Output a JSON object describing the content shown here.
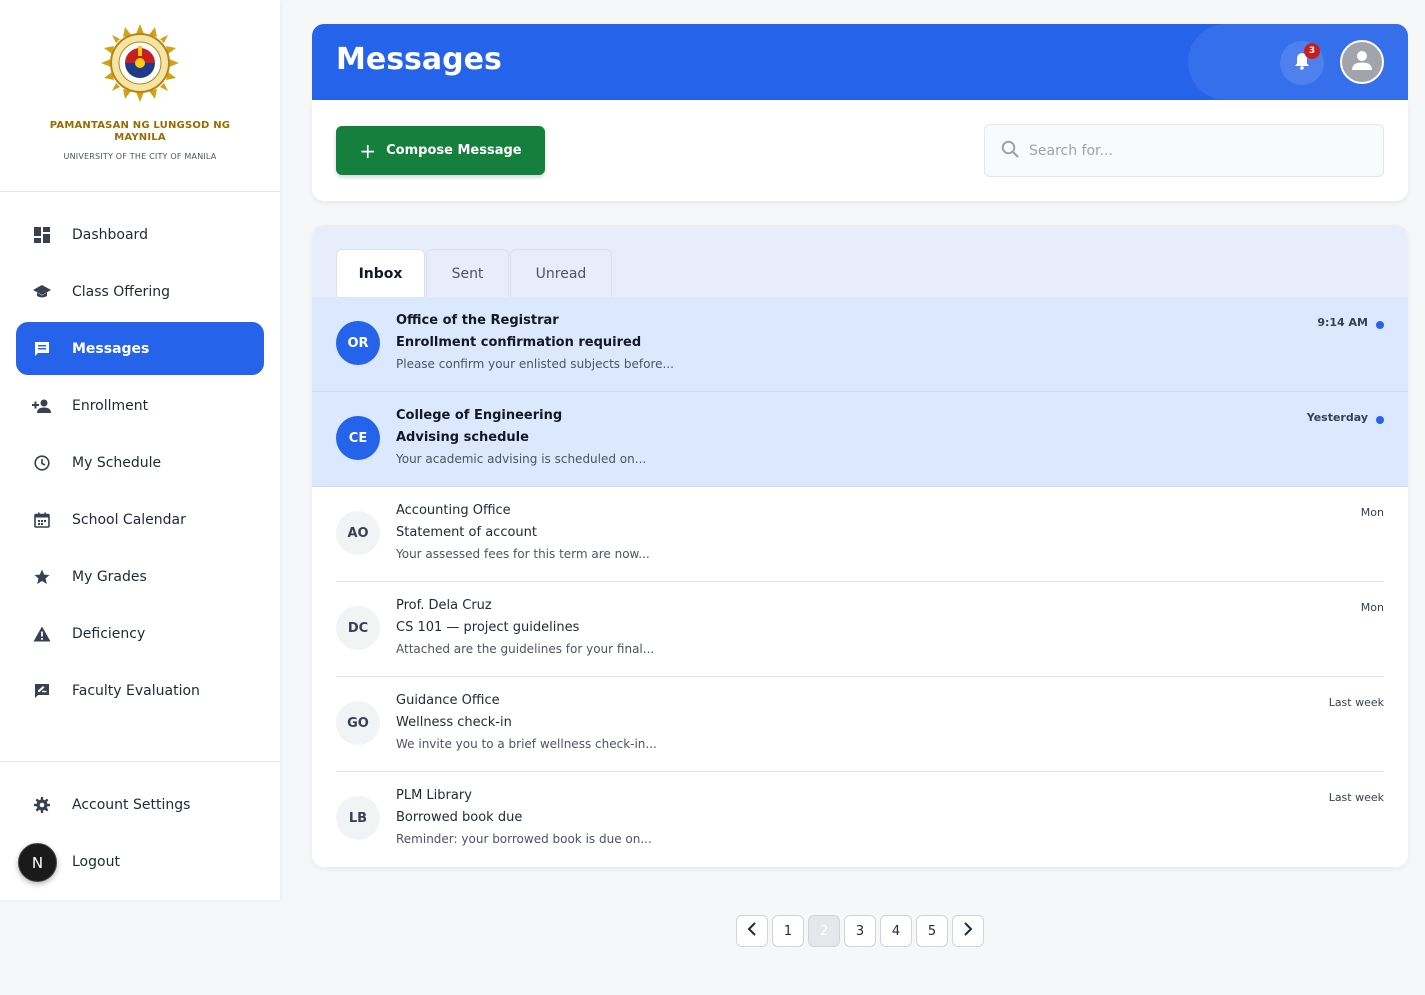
{
  "brand": {
    "name": "PAMANTASAN NG LUNGSOD NG MAYNILA",
    "subtitle": "UNIVERSITY OF THE CITY OF MANILA",
    "seal_icon": "university-seal-icon"
  },
  "sidebar": {
    "items": [
      {
        "label": "Dashboard",
        "icon": "dashboard-icon",
        "active": false
      },
      {
        "label": "Class Offering",
        "icon": "school-cap-icon",
        "active": false
      },
      {
        "label": "Messages",
        "icon": "chat-icon",
        "active": true
      },
      {
        "label": "Enrollment",
        "icon": "person-add-icon",
        "active": false
      },
      {
        "label": "My Schedule",
        "icon": "clock-icon",
        "active": false
      },
      {
        "label": "School Calendar",
        "icon": "calendar-icon",
        "active": false
      },
      {
        "label": "My Grades",
        "icon": "star-icon",
        "active": false
      },
      {
        "label": "Deficiency",
        "icon": "warning-icon",
        "active": false
      },
      {
        "label": "Faculty Evaluation",
        "icon": "rate-review-icon",
        "active": false
      }
    ],
    "bottom": [
      {
        "label": "Account Settings",
        "icon": "gear-icon"
      },
      {
        "label": "Logout",
        "icon": "logout-icon"
      }
    ],
    "floating_badge": "N"
  },
  "header": {
    "title": "Messages",
    "notification_count": "3",
    "accent": "#2563eb"
  },
  "toolbar": {
    "compose_label": "Compose Message",
    "compose_color": "#15803d",
    "search_placeholder": "Search for..."
  },
  "tabs": [
    {
      "label": "Inbox",
      "active": true
    },
    {
      "label": "Sent",
      "active": false
    },
    {
      "label": "Unread",
      "active": false
    }
  ],
  "messages": [
    {
      "initials": "OR",
      "sender": "Office of the Registrar",
      "subject": "Enrollment confirmation required",
      "preview": "Please confirm your enlisted subjects before...",
      "time": "9:14 AM",
      "unread": true
    },
    {
      "initials": "CE",
      "sender": "College of Engineering",
      "subject": "Advising schedule",
      "preview": "Your academic advising is scheduled on...",
      "time": "Yesterday",
      "unread": true
    },
    {
      "initials": "AO",
      "sender": "Accounting Office",
      "subject": "Statement of account",
      "preview": "Your assessed fees for this term are now...",
      "time": "Mon",
      "unread": false
    },
    {
      "initials": "DC",
      "sender": "Prof. Dela Cruz",
      "subject": "CS 101 — project guidelines",
      "preview": "Attached are the guidelines for your final...",
      "time": "Mon",
      "unread": false
    },
    {
      "initials": "GO",
      "sender": "Guidance Office",
      "subject": "Wellness check-in",
      "preview": "We invite you to a brief wellness check-in...",
      "time": "Last week",
      "unread": false
    },
    {
      "initials": "LB",
      "sender": "PLM Library",
      "subject": "Borrowed book due",
      "preview": "Reminder: your borrowed book is due on...",
      "time": "Last week",
      "unread": false
    }
  ],
  "pagination": {
    "pages": [
      "1",
      "2",
      "3",
      "4",
      "5"
    ],
    "current": "2"
  }
}
